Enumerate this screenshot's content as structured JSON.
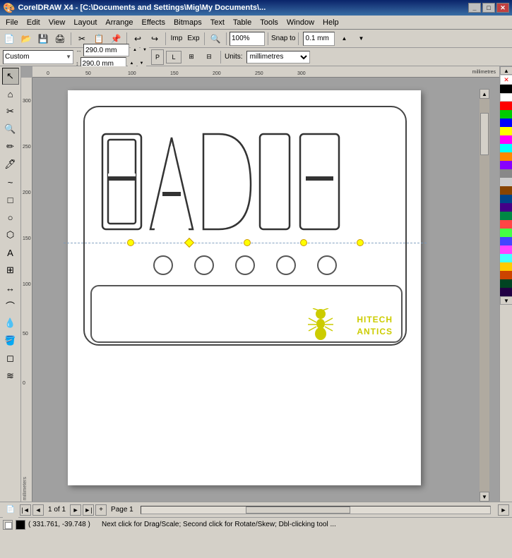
{
  "titlebar": {
    "title": "CorelDRAW X4 - [C:\\Documents and Settings\\Mig\\My Documents\\...",
    "icon": "coreldraw-icon"
  },
  "menubar": {
    "items": [
      "File",
      "Edit",
      "View",
      "Layout",
      "Arrange",
      "Effects",
      "Bitmaps",
      "Text",
      "Table",
      "Tools",
      "Window",
      "Help"
    ]
  },
  "toolbar": {
    "zoom_value": "100%",
    "snap_label": "Snap to",
    "nudge_value": "0.1 mm"
  },
  "propertybar": {
    "page_size_label": "Custom",
    "width": "290.0 mm",
    "height": "290.0 mm",
    "units_label": "Units:",
    "units_value": "millimetres"
  },
  "canvas": {
    "ruler_label": "millimeters",
    "ruler_marks": [
      "0",
      "50",
      "100",
      "150",
      "200",
      "250",
      "300"
    ]
  },
  "statusbar": {
    "page_info": "1 of 1",
    "page_label": "Page 1"
  },
  "infobar": {
    "coords": "( 331.761, -39.748 )",
    "message": "Next click for Drag/Scale; Second click for Rotate/Skew; Dbl-clicking tool ..."
  },
  "colors": {
    "swatches": [
      "#000000",
      "#ffffff",
      "#ff0000",
      "#00aa00",
      "#0000ff",
      "#ffff00",
      "#ff00ff",
      "#00ffff",
      "#ff8800",
      "#8800ff",
      "#888888",
      "#cccccc",
      "#884400",
      "#004488",
      "#440088",
      "#008844",
      "#ff4444",
      "#44ff44",
      "#4444ff",
      "#ff44ff",
      "#44ffff",
      "#ffcc00",
      "#cc4400",
      "#004422",
      "#220044"
    ]
  },
  "design": {
    "eadie_text": "EADIE",
    "hitech_line1": "HITECH",
    "hitech_line2": "ANTICS"
  }
}
